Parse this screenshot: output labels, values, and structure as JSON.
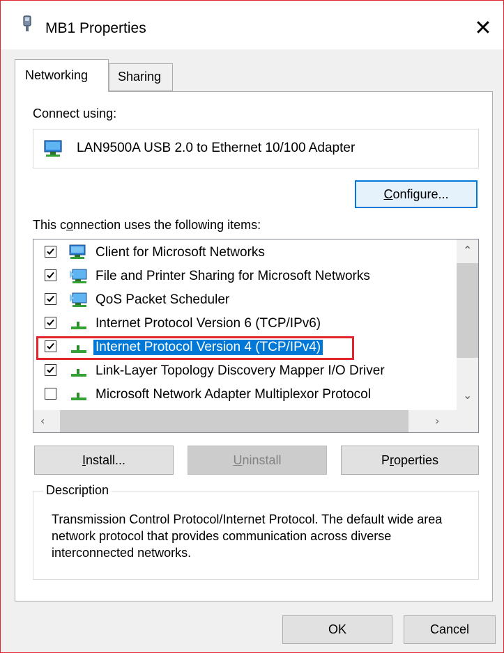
{
  "window": {
    "title": "MB1 Properties",
    "close_glyph": "✕"
  },
  "tabs": [
    {
      "label": "Networking",
      "active": true
    },
    {
      "label": "Sharing",
      "active": false
    }
  ],
  "connect": {
    "label": "Connect using:",
    "adapter": "LAN9500A USB 2.0 to Ethernet 10/100 Adapter",
    "adapter_icon": "network-adapter-icon",
    "configure_pre": "",
    "configure_u": "C",
    "configure_post": "onfigure..."
  },
  "items_label": {
    "pre": "This c",
    "u": "o",
    "post": "nnection uses the following items:"
  },
  "items": [
    {
      "label": "Client for Microsoft Networks",
      "checked": true,
      "icon": "network-client-icon"
    },
    {
      "label": "File and Printer Sharing for Microsoft Networks",
      "checked": true,
      "icon": "network-service-icon"
    },
    {
      "label": "QoS Packet Scheduler",
      "checked": true,
      "icon": "network-service-icon"
    },
    {
      "label": "Internet Protocol Version 6 (TCP/IPv6)",
      "checked": true,
      "icon": "protocol-icon"
    },
    {
      "label": "Internet Protocol Version 4 (TCP/IPv4)",
      "checked": true,
      "icon": "protocol-icon",
      "selected": true
    },
    {
      "label": "Link-Layer Topology Discovery Mapper I/O Driver",
      "checked": true,
      "icon": "protocol-icon"
    },
    {
      "label": "Microsoft Network Adapter Multiplexor Protocol",
      "checked": false,
      "icon": "protocol-icon"
    }
  ],
  "buttons": {
    "install": {
      "u": "I",
      "post": "nstall..."
    },
    "uninstall": {
      "u": "U",
      "post": "ninstall"
    },
    "properties": {
      "pre": "P",
      "u": "r",
      "post": "operties"
    }
  },
  "description": {
    "title": "Description",
    "text": "Transmission Control Protocol/Internet Protocol. The default wide area network protocol that provides communication across diverse interconnected networks."
  },
  "footer": {
    "ok": "OK",
    "cancel": "Cancel"
  },
  "colors": {
    "selection": "#0078d7",
    "highlight_outline": "#e0262c",
    "focus_border": "#0078d7"
  }
}
